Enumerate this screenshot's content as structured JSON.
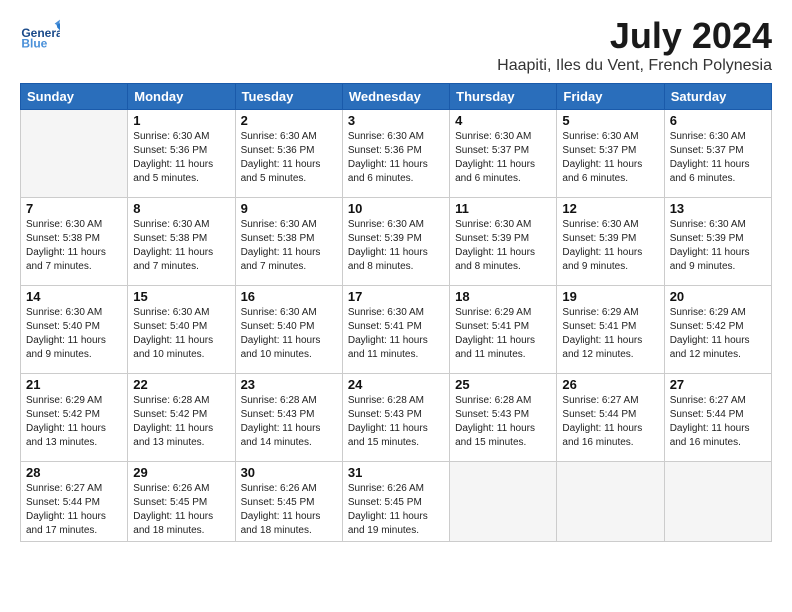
{
  "header": {
    "logo_line1": "General",
    "logo_line2": "Blue",
    "month": "July 2024",
    "location": "Haapiti, Iles du Vent, French Polynesia"
  },
  "days_of_week": [
    "Sunday",
    "Monday",
    "Tuesday",
    "Wednesday",
    "Thursday",
    "Friday",
    "Saturday"
  ],
  "weeks": [
    [
      {
        "day": "",
        "info": ""
      },
      {
        "day": "1",
        "info": "Sunrise: 6:30 AM\nSunset: 5:36 PM\nDaylight: 11 hours\nand 5 minutes."
      },
      {
        "day": "2",
        "info": "Sunrise: 6:30 AM\nSunset: 5:36 PM\nDaylight: 11 hours\nand 5 minutes."
      },
      {
        "day": "3",
        "info": "Sunrise: 6:30 AM\nSunset: 5:36 PM\nDaylight: 11 hours\nand 6 minutes."
      },
      {
        "day": "4",
        "info": "Sunrise: 6:30 AM\nSunset: 5:37 PM\nDaylight: 11 hours\nand 6 minutes."
      },
      {
        "day": "5",
        "info": "Sunrise: 6:30 AM\nSunset: 5:37 PM\nDaylight: 11 hours\nand 6 minutes."
      },
      {
        "day": "6",
        "info": "Sunrise: 6:30 AM\nSunset: 5:37 PM\nDaylight: 11 hours\nand 6 minutes."
      }
    ],
    [
      {
        "day": "7",
        "info": "Sunrise: 6:30 AM\nSunset: 5:38 PM\nDaylight: 11 hours\nand 7 minutes."
      },
      {
        "day": "8",
        "info": "Sunrise: 6:30 AM\nSunset: 5:38 PM\nDaylight: 11 hours\nand 7 minutes."
      },
      {
        "day": "9",
        "info": "Sunrise: 6:30 AM\nSunset: 5:38 PM\nDaylight: 11 hours\nand 7 minutes."
      },
      {
        "day": "10",
        "info": "Sunrise: 6:30 AM\nSunset: 5:39 PM\nDaylight: 11 hours\nand 8 minutes."
      },
      {
        "day": "11",
        "info": "Sunrise: 6:30 AM\nSunset: 5:39 PM\nDaylight: 11 hours\nand 8 minutes."
      },
      {
        "day": "12",
        "info": "Sunrise: 6:30 AM\nSunset: 5:39 PM\nDaylight: 11 hours\nand 9 minutes."
      },
      {
        "day": "13",
        "info": "Sunrise: 6:30 AM\nSunset: 5:39 PM\nDaylight: 11 hours\nand 9 minutes."
      }
    ],
    [
      {
        "day": "14",
        "info": "Sunrise: 6:30 AM\nSunset: 5:40 PM\nDaylight: 11 hours\nand 9 minutes."
      },
      {
        "day": "15",
        "info": "Sunrise: 6:30 AM\nSunset: 5:40 PM\nDaylight: 11 hours\nand 10 minutes."
      },
      {
        "day": "16",
        "info": "Sunrise: 6:30 AM\nSunset: 5:40 PM\nDaylight: 11 hours\nand 10 minutes."
      },
      {
        "day": "17",
        "info": "Sunrise: 6:30 AM\nSunset: 5:41 PM\nDaylight: 11 hours\nand 11 minutes."
      },
      {
        "day": "18",
        "info": "Sunrise: 6:29 AM\nSunset: 5:41 PM\nDaylight: 11 hours\nand 11 minutes."
      },
      {
        "day": "19",
        "info": "Sunrise: 6:29 AM\nSunset: 5:41 PM\nDaylight: 11 hours\nand 12 minutes."
      },
      {
        "day": "20",
        "info": "Sunrise: 6:29 AM\nSunset: 5:42 PM\nDaylight: 11 hours\nand 12 minutes."
      }
    ],
    [
      {
        "day": "21",
        "info": "Sunrise: 6:29 AM\nSunset: 5:42 PM\nDaylight: 11 hours\nand 13 minutes."
      },
      {
        "day": "22",
        "info": "Sunrise: 6:28 AM\nSunset: 5:42 PM\nDaylight: 11 hours\nand 13 minutes."
      },
      {
        "day": "23",
        "info": "Sunrise: 6:28 AM\nSunset: 5:43 PM\nDaylight: 11 hours\nand 14 minutes."
      },
      {
        "day": "24",
        "info": "Sunrise: 6:28 AM\nSunset: 5:43 PM\nDaylight: 11 hours\nand 15 minutes."
      },
      {
        "day": "25",
        "info": "Sunrise: 6:28 AM\nSunset: 5:43 PM\nDaylight: 11 hours\nand 15 minutes."
      },
      {
        "day": "26",
        "info": "Sunrise: 6:27 AM\nSunset: 5:44 PM\nDaylight: 11 hours\nand 16 minutes."
      },
      {
        "day": "27",
        "info": "Sunrise: 6:27 AM\nSunset: 5:44 PM\nDaylight: 11 hours\nand 16 minutes."
      }
    ],
    [
      {
        "day": "28",
        "info": "Sunrise: 6:27 AM\nSunset: 5:44 PM\nDaylight: 11 hours\nand 17 minutes."
      },
      {
        "day": "29",
        "info": "Sunrise: 6:26 AM\nSunset: 5:45 PM\nDaylight: 11 hours\nand 18 minutes."
      },
      {
        "day": "30",
        "info": "Sunrise: 6:26 AM\nSunset: 5:45 PM\nDaylight: 11 hours\nand 18 minutes."
      },
      {
        "day": "31",
        "info": "Sunrise: 6:26 AM\nSunset: 5:45 PM\nDaylight: 11 hours\nand 19 minutes."
      },
      {
        "day": "",
        "info": ""
      },
      {
        "day": "",
        "info": ""
      },
      {
        "day": "",
        "info": ""
      }
    ]
  ]
}
